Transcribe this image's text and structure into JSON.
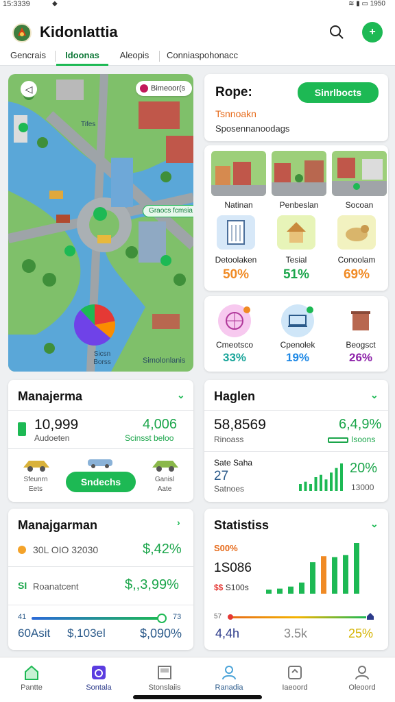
{
  "status": {
    "time": "15:3339",
    "right": "1950"
  },
  "app": {
    "title": "Kidonlattia"
  },
  "tabs": [
    "Gencrais",
    "Idoonas",
    "Aleopis",
    "Conniaspohonacc"
  ],
  "map": {
    "badge": "Bimeoor(s",
    "river_label": "Tifes",
    "chip": "Graocs fcmsia",
    "pie_label_1": "Sicsn",
    "pie_label_2": "Borss",
    "footer": "Simolonlanis",
    "pie": [
      {
        "color": "#e53935",
        "value": 22
      },
      {
        "color": "#fb8c00",
        "value": 14
      },
      {
        "color": "#6f42e8",
        "value": 52
      },
      {
        "color": "#1db954",
        "value": 12
      }
    ]
  },
  "hope": {
    "title": "Rope:",
    "button": "Sinrlbocts",
    "line1": "Tsnnoakn",
    "line2": "Sposennanoodags"
  },
  "places": {
    "thumbs": [
      "Natinan",
      "Penbeslan",
      "Socoan"
    ],
    "tiles": [
      {
        "label": "Detoolaken",
        "pct": "50%",
        "color": "#f08a24",
        "icon": "building-icon"
      },
      {
        "label": "Tesial",
        "pct": "51%",
        "color": "#1aa54a",
        "icon": "house-icon"
      },
      {
        "label": "Conoolam",
        "pct": "69%",
        "color": "#f08a24",
        "icon": "animal-icon"
      }
    ]
  },
  "metrics": [
    {
      "label": "Cmeotsco",
      "pct": "33%",
      "color": "#1aa59a",
      "icon": "wheel-icon"
    },
    {
      "label": "Cpenolek",
      "pct": "19%",
      "color": "#1e88e5",
      "icon": "cart-icon"
    },
    {
      "label": "Beogsct",
      "pct": "26%",
      "color": "#8e24aa",
      "icon": "trash-icon"
    }
  ],
  "management1": {
    "title": "Manajerma",
    "value_1": "10,999",
    "sub_1": "Audoeten",
    "value_2": "4,006",
    "sub_2": "Scinsst beloo",
    "vehicle_1_label_1": "Sfeunrn",
    "vehicle_1_label_2": "Eets",
    "button": "Sndechs",
    "vehicle_2_label_1": "Ganisl",
    "vehicle_2_label_2": "Aate"
  },
  "hagler": {
    "title": "Haglen",
    "value_1": "58,8569",
    "sub_1": "Rinoass",
    "value_2": "6,4,9%",
    "sub_2": "Isoons",
    "stat_title": "Sate Saha",
    "stat_value": "27",
    "stat_sub": "Satnoes",
    "trend_pct": "20%",
    "trend_sub": "13000",
    "bars": [
      3,
      4,
      3,
      6,
      7,
      5,
      8,
      10,
      12
    ]
  },
  "management2": {
    "title": "Manajgarman",
    "row1_text": "30L OIO 32030",
    "row1_value": "$,42%",
    "row2_text": "Roanatcent",
    "row2_value": "$,,3,99%",
    "row2_icon_label": "SI",
    "slider_min": "41",
    "slider_max": "73",
    "slider_level": 0.98,
    "foot_left": "60Asit",
    "foot_mid": "$,103el",
    "foot_right": "$,090%"
  },
  "statistics": {
    "title": "Statistiss",
    "label_1": "S00%",
    "value": "1S086",
    "label_2": "S100s",
    "label_2_prefix": "$$",
    "bars": [
      {
        "value": 8,
        "color": "#1db954"
      },
      {
        "value": 10,
        "color": "#1db954"
      },
      {
        "value": 14,
        "color": "#1db954"
      },
      {
        "value": 22,
        "color": "#1db954"
      },
      {
        "value": 62,
        "color": "#1db954"
      },
      {
        "value": 74,
        "color": "#f08a24"
      },
      {
        "value": 72,
        "color": "#1db954"
      },
      {
        "value": 76,
        "color": "#1db954"
      },
      {
        "value": 100,
        "color": "#1db954"
      }
    ],
    "scale_left": "57",
    "foot_1": "4,4h",
    "foot_2": "3.5k",
    "foot_3": "25%"
  },
  "nav": [
    {
      "label": "Pantte",
      "icon": "home-icon",
      "color": "#1db954"
    },
    {
      "label": "Sontala",
      "icon": "chart-icon",
      "color": "#5b3de0"
    },
    {
      "label": "Stonslaiis",
      "icon": "document-icon",
      "color": "#777"
    },
    {
      "label": "Ranadia",
      "icon": "profile-icon",
      "color": "#4aa3d8"
    },
    {
      "label": "Iaeoord",
      "icon": "inbox-icon",
      "color": "#777"
    },
    {
      "label": "Oleoord",
      "icon": "user-icon",
      "color": "#777"
    }
  ]
}
